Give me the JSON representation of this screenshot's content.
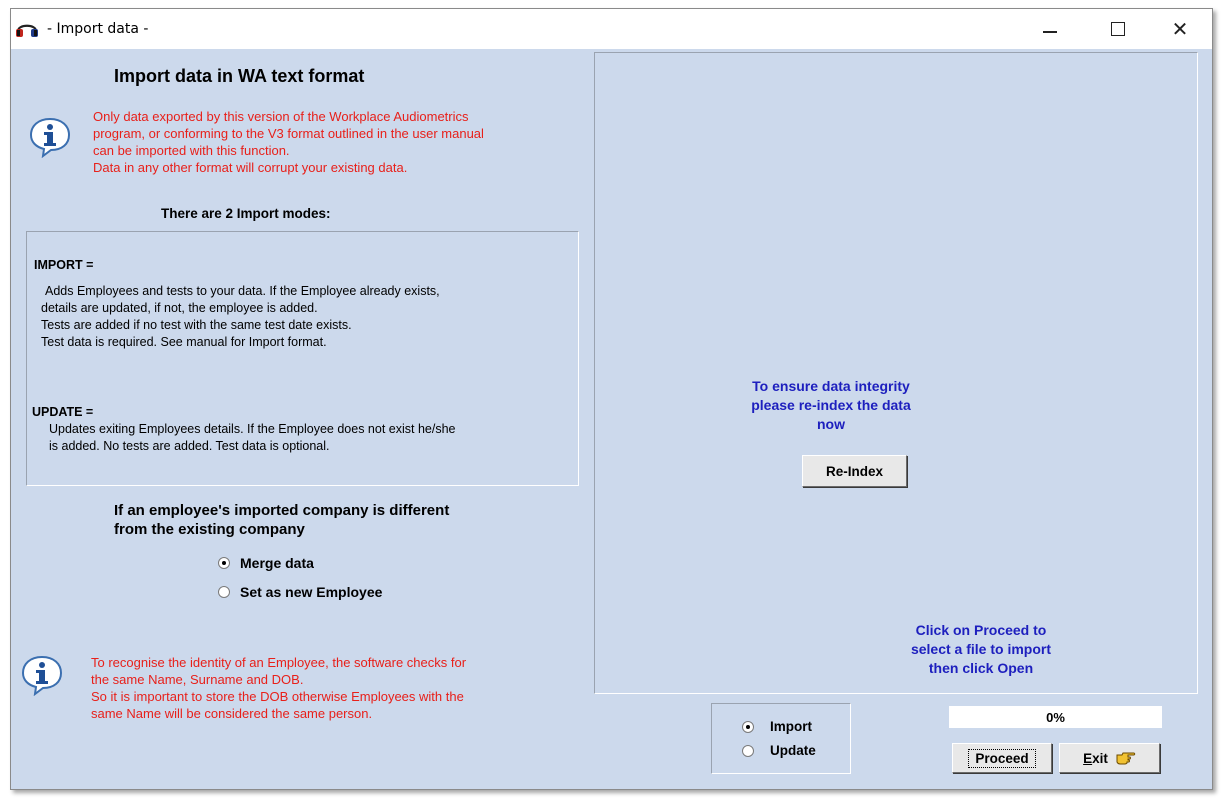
{
  "window": {
    "title": "- Import data -",
    "app_icon": "headphones-icon"
  },
  "left": {
    "heading": "Import data in WA text format",
    "warning_lines": [
      "Only data exported by this version of the Workplace Audiometrics",
      "program, or conforming to the V3 format outlined in the user manual",
      "can be imported with this function.",
      "Data in any other format will corrupt your existing data."
    ],
    "modes_title": "There are 2 Import modes:",
    "import_label": "IMPORT =",
    "import_desc_lines": [
      "Adds Employees and tests to your data. If the Employee already exists,",
      "details are updated, if not, the employee is added.",
      "Tests are added if no test with the same test date exists.",
      "Test data is required. See manual for Import format."
    ],
    "update_label": "UPDATE =",
    "update_desc_lines": [
      "Updates exiting Employees details. If the Employee does not exist he/she",
      "is added. No tests are added. Test data is optional."
    ],
    "company_question_lines": [
      "If an employee's imported company is different",
      "from the existing company"
    ],
    "company_options": [
      {
        "label": "Merge data",
        "selected": true
      },
      {
        "label": "Set as new Employee",
        "selected": false
      }
    ],
    "identity_lines": [
      "To recognise the identity of an Employee, the software checks for",
      "the same Name, Surname and DOB.",
      "So it is important to store the DOB otherwise Employees with the",
      "same Name will be considered the same person."
    ]
  },
  "right": {
    "integrity_lines": [
      "To ensure data integrity",
      "please re-index the data",
      "now"
    ],
    "reindex_label": "Re-Index",
    "proceed_hint_lines": [
      "Click on Proceed to",
      "select a file to import",
      "then click Open"
    ]
  },
  "bottom": {
    "mode_options": [
      {
        "label": "Import",
        "selected": true
      },
      {
        "label": "Update",
        "selected": false
      }
    ],
    "progress_text": "0%",
    "progress_value": 0,
    "proceed_label": "Proceed",
    "exit_label_underlined": "E",
    "exit_label_rest": "xit",
    "exit_icon": "pointing-hand-icon"
  },
  "colors": {
    "background": "#ccd9ec",
    "warning_red": "#e8201a",
    "hint_blue": "#1d1fbe"
  }
}
